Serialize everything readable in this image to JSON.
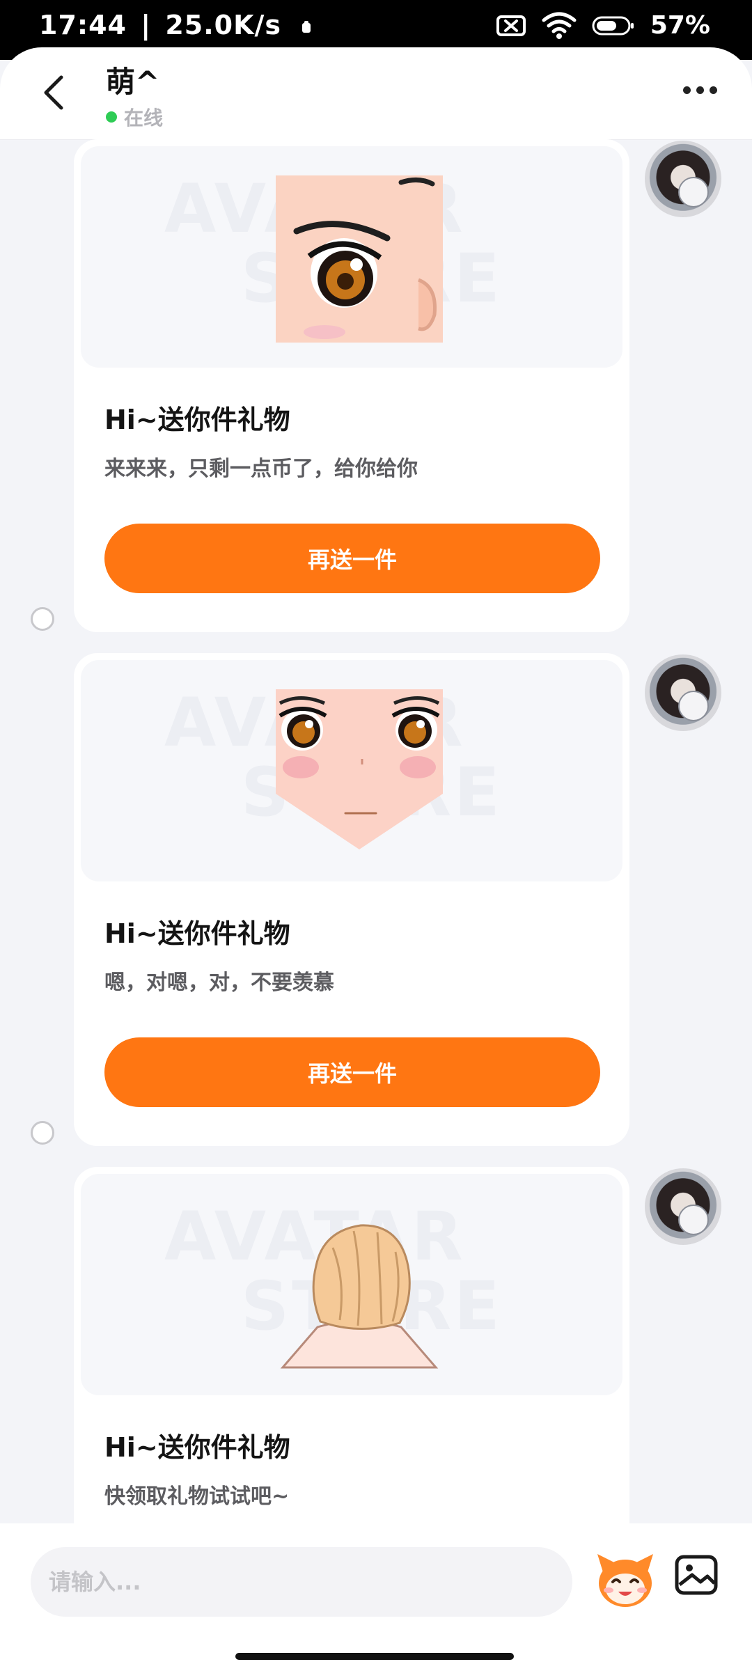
{
  "status_bar": {
    "time": "17:44",
    "separator": "|",
    "net_speed": "25.0K/s",
    "battery_percent": "57%",
    "icons": [
      "sim-off-icon",
      "wifi-icon",
      "battery-icon"
    ]
  },
  "header": {
    "contact_name": "萌^",
    "online_status": "在线",
    "icons": [
      "back-arrow-icon",
      "more-dots-icon"
    ]
  },
  "messages": [
    {
      "title": "Hi~送你件礼物",
      "text": "来来来，只剩一点币了，给你给你",
      "button_label": "再送一件",
      "gift_icon": "anime-eye-icon"
    },
    {
      "title": "Hi~送你件礼物",
      "text": "嗯，对嗯，对，不要羡慕",
      "button_label": "再送一件",
      "gift_icon": "anime-face-icon"
    },
    {
      "title": "Hi~送你件礼物",
      "text": "快领取礼物试试吧~",
      "gift_icon": "hair-bun-icon"
    }
  ],
  "input_bar": {
    "placeholder": "请输入...",
    "icons": [
      "emoji-mascot-icon",
      "image-icon"
    ]
  },
  "colors": {
    "accent": "#ff7612",
    "online": "#2ecc55",
    "background": "#f3f4f8"
  }
}
